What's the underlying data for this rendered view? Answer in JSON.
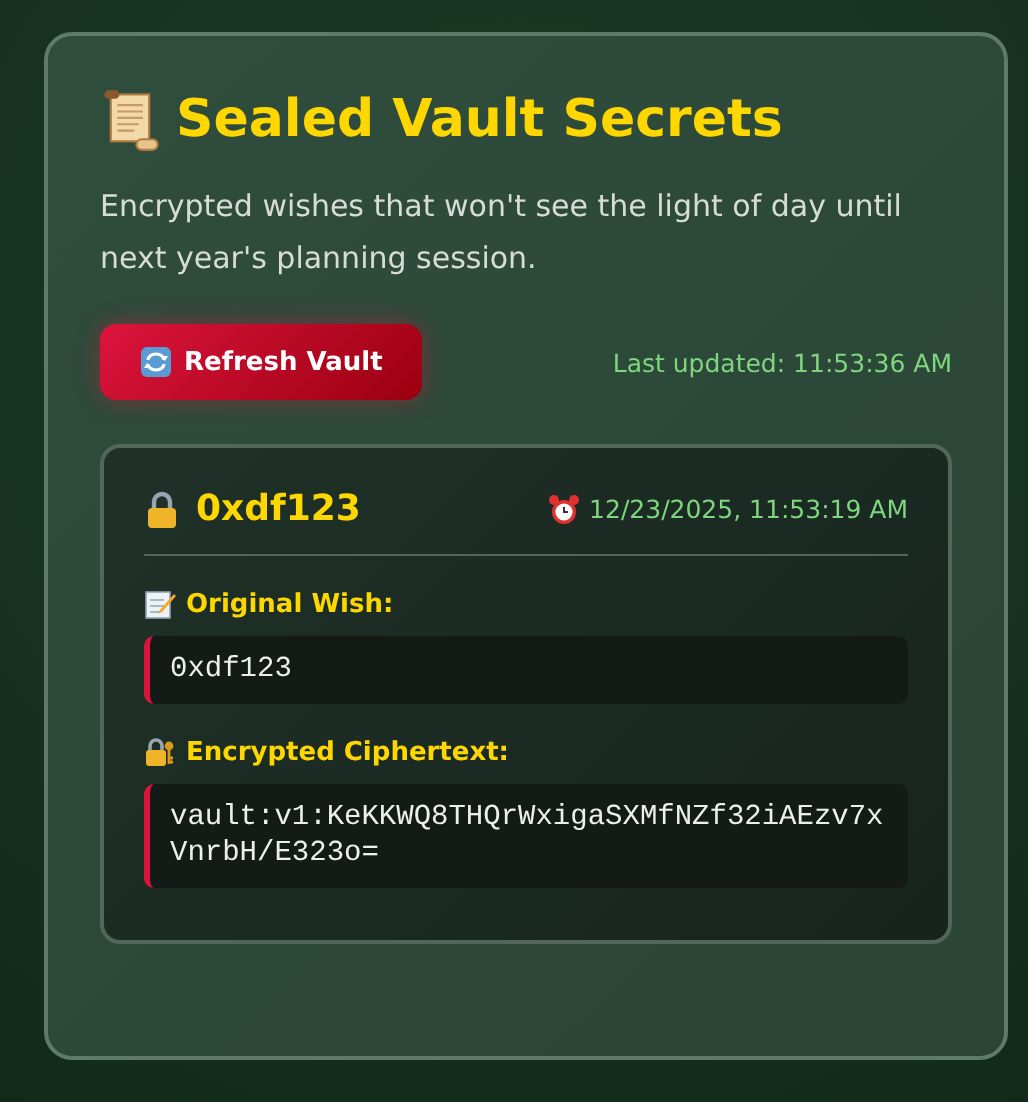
{
  "title": "Sealed Vault Secrets",
  "description": "Encrypted wishes that won't see the light of day until next year's planning session.",
  "refresh_button": {
    "label": "Refresh Vault"
  },
  "last_updated": "Last updated: 11:53:36 AM",
  "entries": [
    {
      "name": "0xdf123",
      "timestamp": "12/23/2025, 11:53:19 AM",
      "fields": [
        {
          "kind": "wish",
          "label": "Original Wish:",
          "value": "0xdf123"
        },
        {
          "kind": "cipher",
          "label": "Encrypted Ciphertext:",
          "value": "vault:v1:KeKKWQ8THQrWxigaSXMfNZf32iAEzv7xVnrbH/E323o="
        }
      ]
    }
  ]
}
